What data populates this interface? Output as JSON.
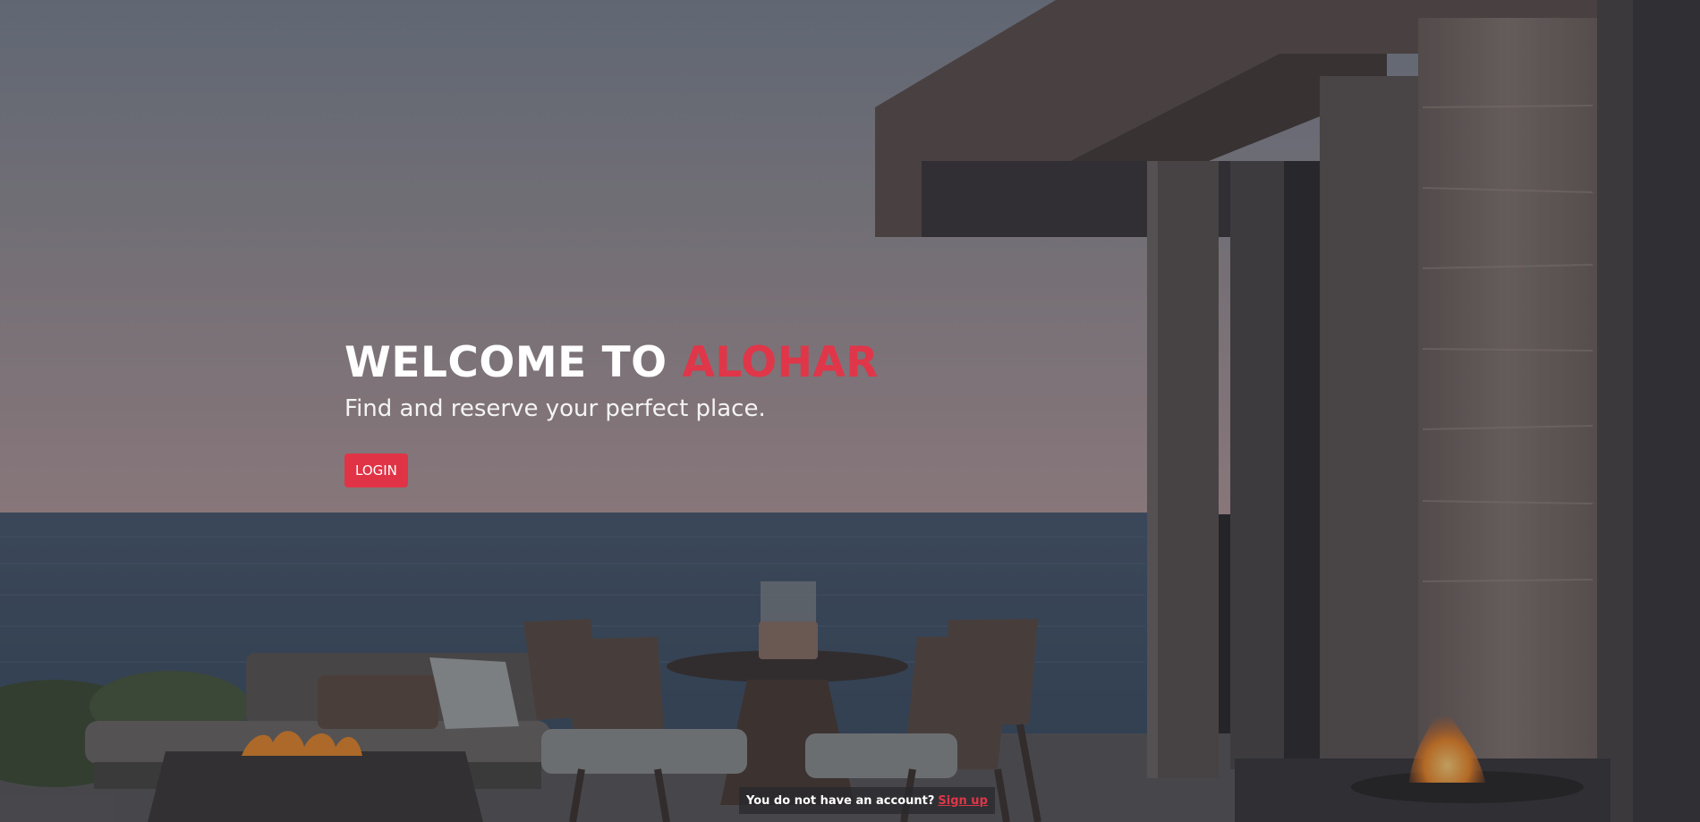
{
  "hero": {
    "headline_prefix": "WELCOME TO ",
    "headline_brand": "ALOHAR",
    "subtitle": "Find and reserve your perfect place.",
    "login_label": "LOGIN"
  },
  "signup": {
    "prompt": "You do not have an account?",
    "link_label": "Sign up"
  },
  "colors": {
    "brand": "#e03649",
    "button": "#e03446",
    "text": "#ffffff"
  }
}
